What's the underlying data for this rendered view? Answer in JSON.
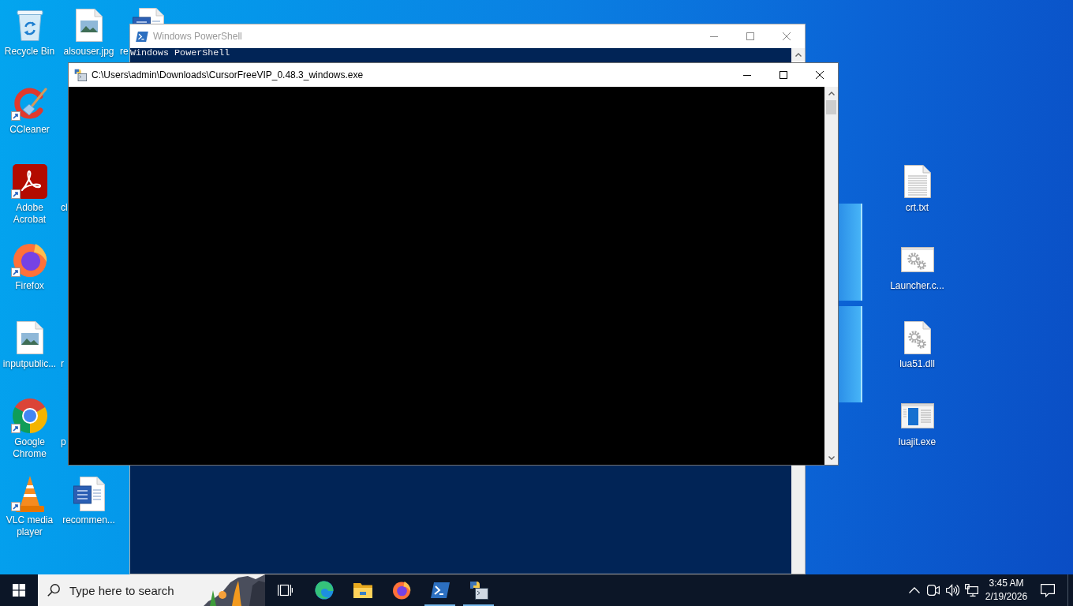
{
  "desktop": {
    "icon_columns": [
      [
        {
          "label": "Recycle Bin",
          "kind": "recycle-bin",
          "shortcut": false
        },
        {
          "label": "CCleaner",
          "kind": "ccleaner",
          "shortcut": true
        },
        {
          "label": "Adobe Acrobat",
          "kind": "acrobat",
          "shortcut": true
        },
        {
          "label": "Firefox",
          "kind": "firefox",
          "shortcut": true
        },
        {
          "label": "inputpublic...",
          "kind": "image-file",
          "shortcut": false
        },
        {
          "label": "Google Chrome",
          "kind": "chrome",
          "shortcut": true
        },
        {
          "label": "VLC media player",
          "kind": "vlc",
          "shortcut": true
        }
      ],
      [
        {
          "label": "alsouser.jpg",
          "kind": "image-file",
          "shortcut": false
        },
        {
          "label": "cl"
        },
        {
          "label": "r"
        },
        {
          "label": "p"
        },
        {
          "label": "recommen...",
          "kind": "word-doc",
          "shortcut": false
        }
      ],
      [
        {
          "label": "re",
          "kind": "word-doc"
        }
      ]
    ],
    "right_icons": [
      {
        "label": "crt.txt",
        "kind": "text-file",
        "shortcut": false
      },
      {
        "label": "Launcher.c...",
        "kind": "settings-window",
        "shortcut": false
      },
      {
        "label": "lua51.dll",
        "kind": "settings-file",
        "shortcut": false
      },
      {
        "label": "luajit.exe",
        "kind": "app-window",
        "shortcut": false
      }
    ]
  },
  "windows": [
    {
      "kind": "powershell",
      "title": "Windows PowerShell",
      "active": false,
      "lines": [
        "Windows PowerShell"
      ]
    },
    {
      "kind": "python-console",
      "title": "C:\\Users\\admin\\Downloads\\CursorFreeVIP_0.48.3_windows.exe",
      "active": true
    }
  ],
  "taskbar": {
    "search": {
      "placeholder": "Type here to search"
    },
    "apps": [
      {
        "kind": "edge",
        "running": false
      },
      {
        "kind": "file-explorer",
        "running": false
      },
      {
        "kind": "firefox",
        "running": false
      },
      {
        "kind": "powershell",
        "running": true
      },
      {
        "kind": "python-console",
        "running": true
      }
    ],
    "clock": {
      "time": "3:45 AM",
      "date": "2/19/2026"
    }
  }
}
